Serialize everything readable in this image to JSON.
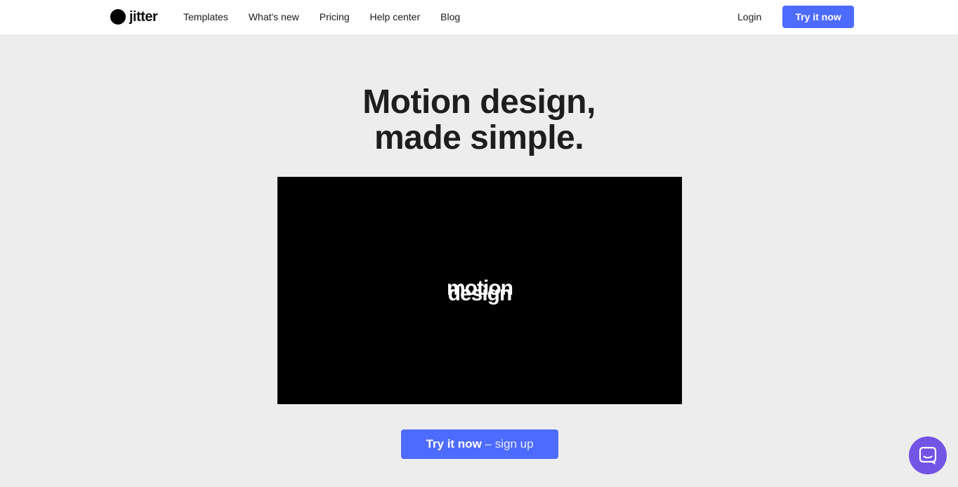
{
  "brand": {
    "name": "jitter",
    "accent": "#4e6bff",
    "chat_color": "#7355e6"
  },
  "nav": {
    "items": [
      {
        "label": "Templates"
      },
      {
        "label": "What's new"
      },
      {
        "label": "Pricing"
      },
      {
        "label": "Help center"
      },
      {
        "label": "Blog"
      }
    ],
    "login_label": "Login",
    "try_label": "Try it now"
  },
  "hero": {
    "headline_line1": "Motion design,",
    "headline_line2": "made simple.",
    "video": {
      "word1": "motion",
      "word2": "design"
    },
    "cta": {
      "strong": "Try it now",
      "light": "– sign up"
    }
  },
  "chat": {
    "icon": "chat-bubble-icon"
  }
}
